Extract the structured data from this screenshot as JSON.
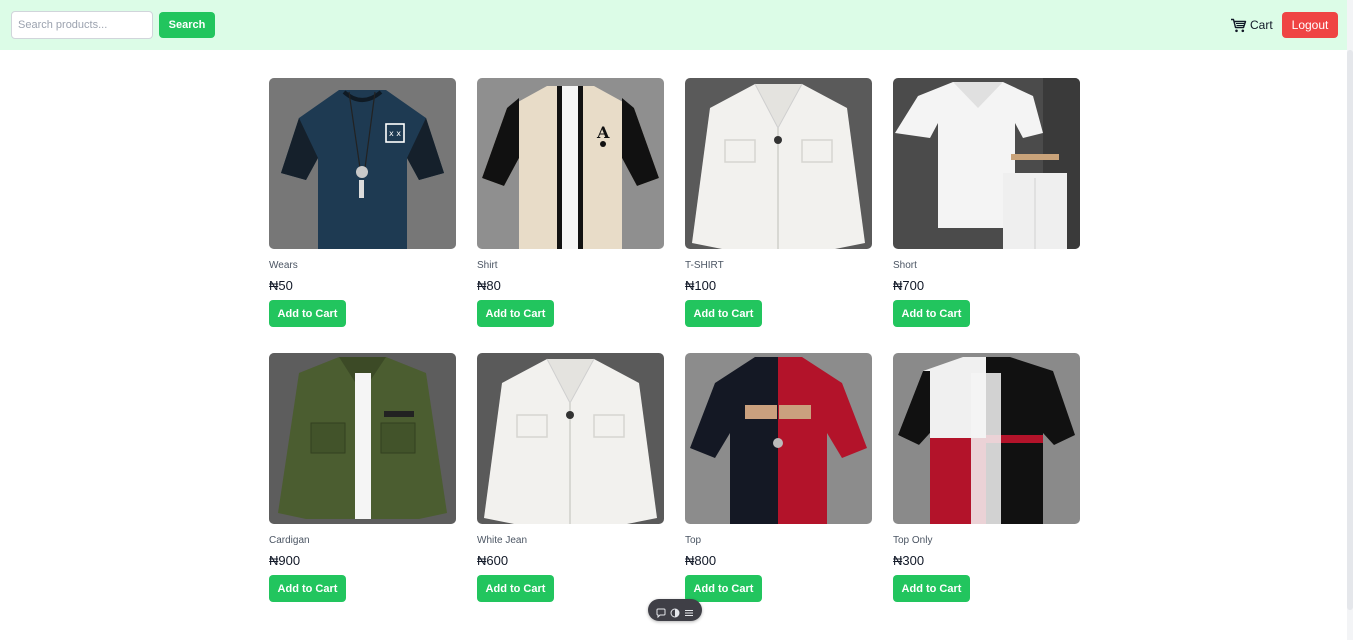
{
  "header": {
    "search_placeholder": "Search products...",
    "search_label": "Search",
    "cart_label": "Cart",
    "logout_label": "Logout",
    "accent": "#22c55e",
    "danger": "#ef4444",
    "background": "#dcfce7"
  },
  "products": [
    {
      "name": "Wears",
      "price": "₦50",
      "button": "Add to Cart",
      "image": "navy-tshirt-with-pendant"
    },
    {
      "name": "Shirt",
      "price": "₦80",
      "button": "Add to Cart",
      "image": "beige-black-varsity-shirt"
    },
    {
      "name": "T-SHIRT",
      "price": "₦100",
      "button": "Add to Cart",
      "image": "white-denim-jacket"
    },
    {
      "name": "Short",
      "price": "₦700",
      "button": "Add to Cart",
      "image": "white-shirt-and-shorts-set"
    },
    {
      "name": "Cardigan",
      "price": "₦900",
      "button": "Add to Cart",
      "image": "olive-green-jacket"
    },
    {
      "name": "White Jean",
      "price": "₦600",
      "button": "Add to Cart",
      "image": "white-denim-jacket"
    },
    {
      "name": "Top",
      "price": "₦800",
      "button": "Add to Cart",
      "image": "black-red-split-tshirt"
    },
    {
      "name": "Top Only",
      "price": "₦300",
      "button": "Add to Cart",
      "image": "black-white-red-block-shirt"
    }
  ]
}
